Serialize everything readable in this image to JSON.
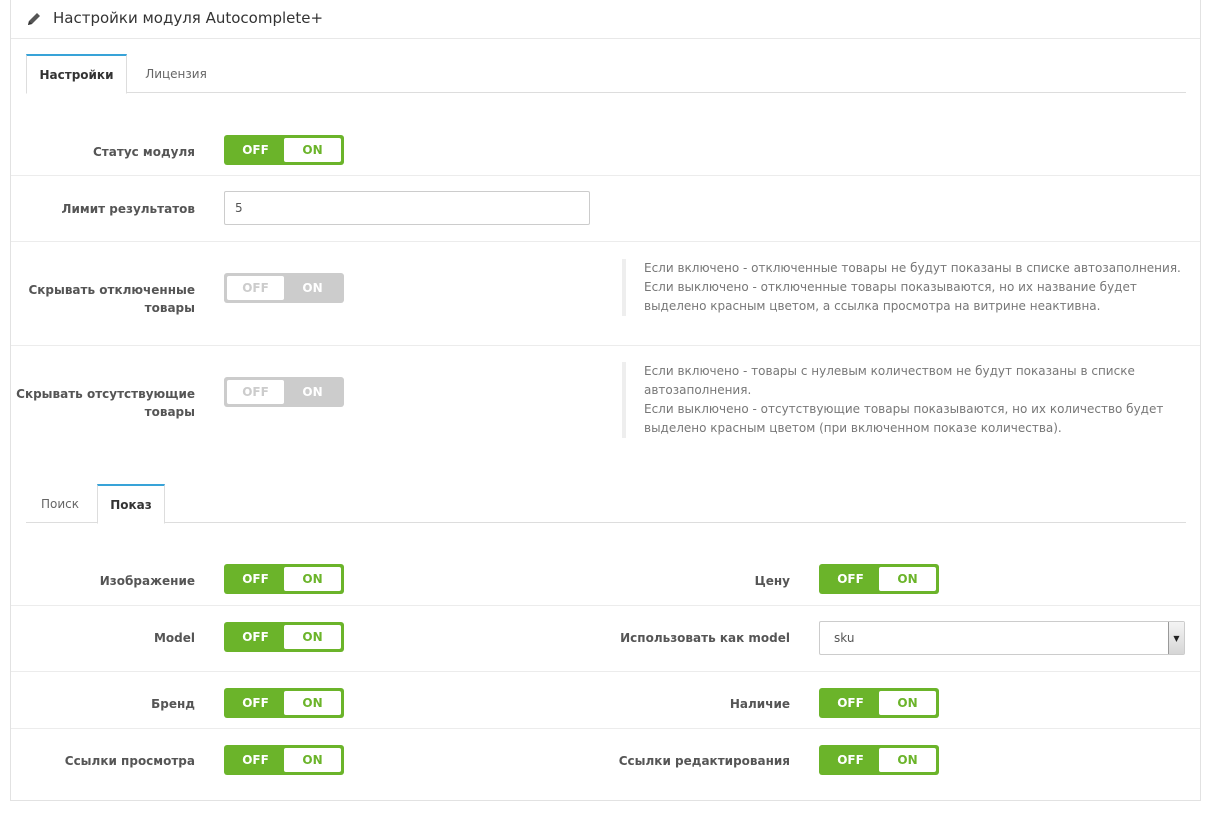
{
  "panel": {
    "title": "Настройки модуля Autocomplete+",
    "icon": "pencil-icon"
  },
  "main_tabs": [
    {
      "label": "Настройки",
      "active": true
    },
    {
      "label": "Лицензия",
      "active": false
    }
  ],
  "settings": {
    "status": {
      "label": "Статус модуля",
      "off": "OFF",
      "on": "ON",
      "state": "on"
    },
    "limit": {
      "label": "Лимит результатов",
      "value": "5"
    },
    "hide_disabled": {
      "label_line1": "Скрывать отключенные",
      "label_line2": "товары",
      "off": "OFF",
      "on": "ON",
      "state": "off",
      "help": [
        "Если включено - отключенные товары не будут показаны в списке автозаполнения.",
        "Если выключено - отключенные товары показываются, но их название будет",
        "выделено красным цветом, а ссылка просмотра на витрине неактивна."
      ]
    },
    "hide_missing": {
      "label_line1": "Скрывать отсутствующие",
      "label_line2": "товары",
      "off": "OFF",
      "on": "ON",
      "state": "off",
      "help": [
        "Если включено - товары с нулевым количеством не будут показаны в списке",
        "автозаполнения.",
        "Если выключено - отсутствующие товары показываются, но их количество будет",
        "выделено красным цветом (при включенном показе количества)."
      ]
    }
  },
  "sub_tabs": [
    {
      "label": "Поиск",
      "active": false
    },
    {
      "label": "Показ",
      "active": true
    }
  ],
  "display": {
    "image": {
      "label": "Изображение",
      "off": "OFF",
      "on": "ON",
      "state": "on"
    },
    "price": {
      "label": "Цену",
      "off": "OFF",
      "on": "ON",
      "state": "on"
    },
    "model": {
      "label": "Model",
      "off": "OFF",
      "on": "ON",
      "state": "on"
    },
    "use_as_model": {
      "label": "Использовать как model",
      "value": "sku"
    },
    "brand": {
      "label": "Бренд",
      "off": "OFF",
      "on": "ON",
      "state": "on"
    },
    "stock": {
      "label": "Наличие",
      "off": "OFF",
      "on": "ON",
      "state": "on"
    },
    "view_links": {
      "label": "Ссылки просмотра",
      "off": "OFF",
      "on": "ON",
      "state": "on"
    },
    "edit_links": {
      "label": "Ссылки редактирования",
      "off": "OFF",
      "on": "ON",
      "state": "on"
    }
  },
  "colors": {
    "toggle_on": "#6bb42a",
    "toggle_off": "#cccccc",
    "tab_accent": "#38a3d8"
  }
}
